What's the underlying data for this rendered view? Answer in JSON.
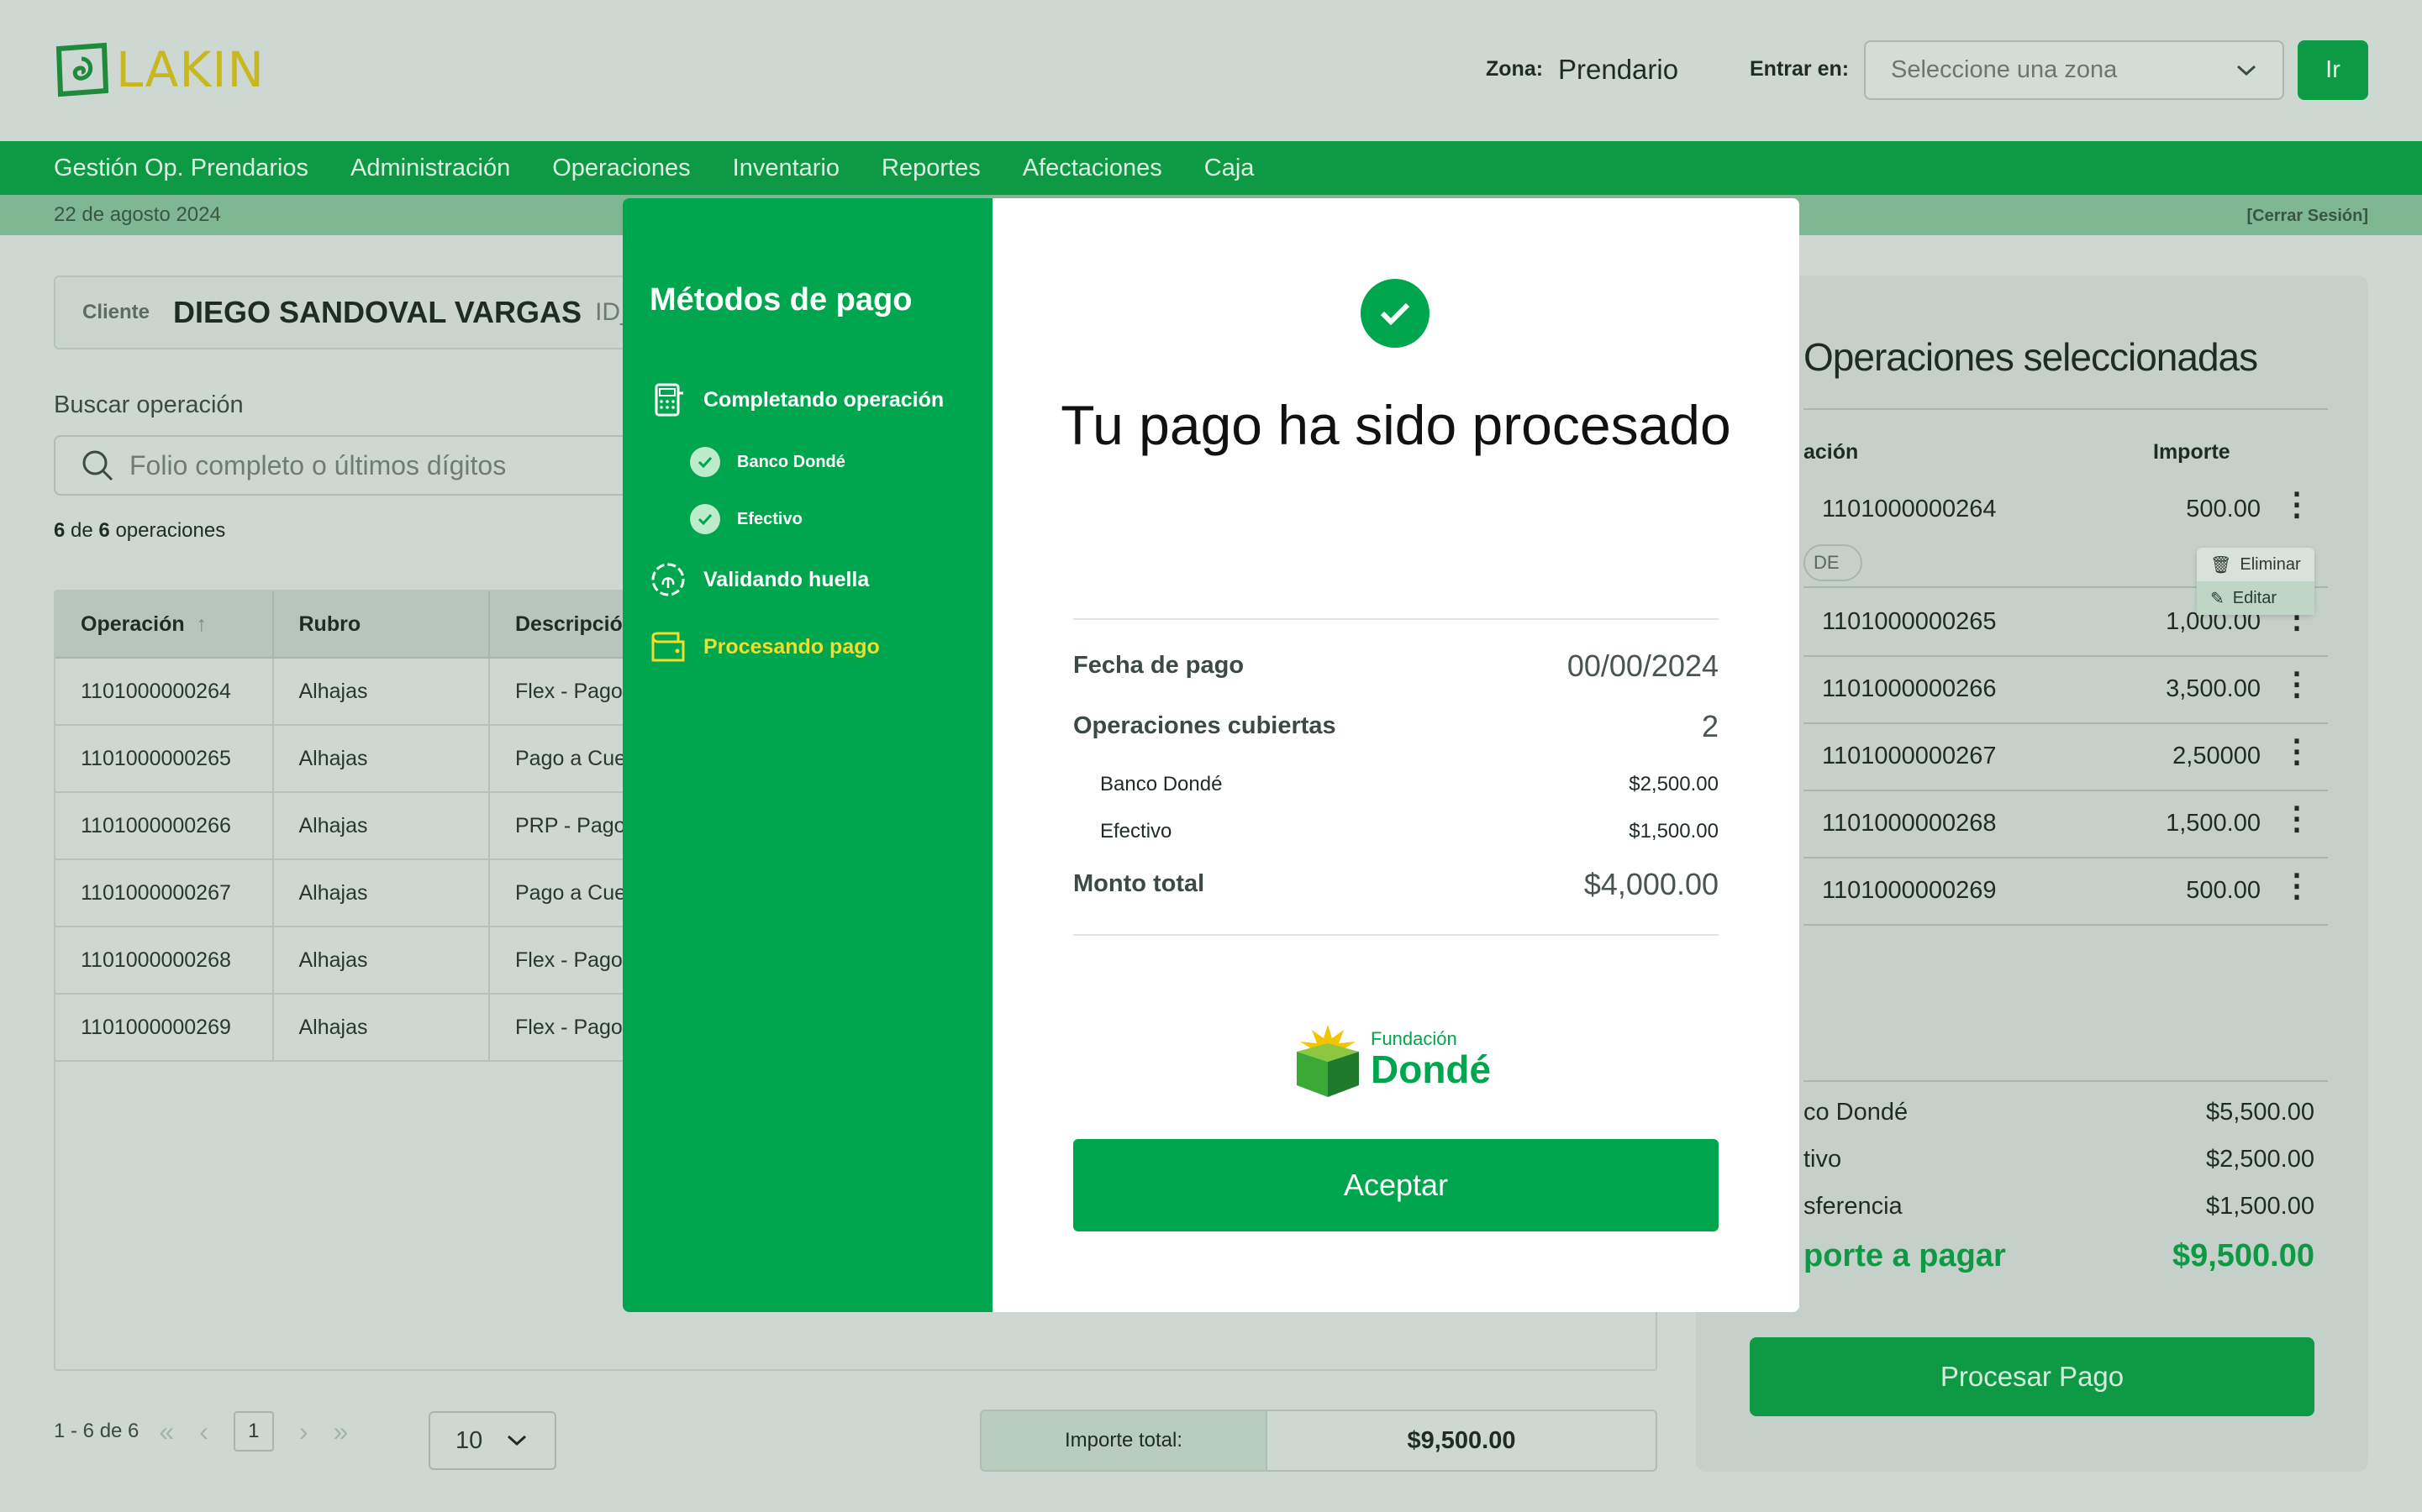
{
  "header": {
    "logo_text": "LAKIN",
    "zona_label": "Zona:",
    "zona_value": "Prendario",
    "entrar_label": "Entrar en:",
    "zone_placeholder": "Seleccione una zona",
    "go_label": "Ir"
  },
  "nav": [
    "Gestión Op. Prendarios",
    "Administración",
    "Operaciones",
    "Inventario",
    "Reportes",
    "Afectaciones",
    "Caja"
  ],
  "subbar": {
    "date": "22 de agosto 2024",
    "logout": "[Cerrar Sesión]"
  },
  "client": {
    "label": "Cliente",
    "name": "DIEGO SANDOVAL VARGAS",
    "id": "ID_"
  },
  "search": {
    "label": "Buscar operación",
    "placeholder": "Folio completo o últimos dígitos"
  },
  "count": {
    "shown": "6",
    "of_text": "de",
    "total": "6",
    "suffix": "operaciones"
  },
  "table": {
    "headers": [
      "Operación",
      "Rubro",
      "Descripció"
    ],
    "rows": [
      [
        "1101000000264",
        "Alhajas",
        "Flex - Pago"
      ],
      [
        "1101000000265",
        "Alhajas",
        "Pago a Cue"
      ],
      [
        "1101000000266",
        "Alhajas",
        "PRP - Pago"
      ],
      [
        "1101000000267",
        "Alhajas",
        "Pago a Cue"
      ],
      [
        "1101000000268",
        "Alhajas",
        "Flex - Pago"
      ],
      [
        "1101000000269",
        "Alhajas",
        "Flex - Pago"
      ]
    ]
  },
  "pagination": {
    "range": "1 - 6 de 6",
    "page": "1",
    "per_page": "10"
  },
  "importe_total": {
    "label": "Importe total:",
    "value": "$9,500.00"
  },
  "selected": {
    "title": "Operaciones seleccionadas",
    "head_op": "ación",
    "head_imp": "Importe",
    "rows": [
      {
        "op": "1101000000264",
        "amount": "500.00"
      },
      {
        "op": "1101000000265",
        "amount": "1,000.00"
      },
      {
        "op": "1101000000266",
        "amount": "3,500.00"
      },
      {
        "op": "1101000000267",
        "amount": "2,50000"
      },
      {
        "op": "1101000000268",
        "amount": "1,500.00"
      },
      {
        "op": "1101000000269",
        "amount": "500.00"
      }
    ],
    "tag": "DE",
    "menu": {
      "delete": "Eliminar",
      "edit": "Editar"
    },
    "summary": [
      {
        "label": "co Dondé",
        "value": "$5,500.00"
      },
      {
        "label": "tivo",
        "value": "$2,500.00"
      },
      {
        "label": "sferencia",
        "value": "$1,500.00"
      }
    ],
    "total_label": "porte a pagar",
    "total_value": "$9,500.00",
    "process_label": "Procesar Pago"
  },
  "modal": {
    "side_title": "Métodos de pago",
    "steps": {
      "completing": "Completando operación",
      "sub1": "Banco Dondé",
      "sub2": "Efectivo",
      "validating": "Validando huella",
      "processing": "Procesando pago"
    },
    "title": "Tu pago ha sido procesado",
    "fecha_label": "Fecha de pago",
    "fecha_value": "00/00/2024",
    "ops_label": "Operaciones cubiertas",
    "ops_value": "2",
    "banco_label": "Banco Dondé",
    "banco_value": "$2,500.00",
    "efectivo_label": "Efectivo",
    "efectivo_value": "$1,500.00",
    "monto_label": "Monto total",
    "monto_value": "$4,000.00",
    "fund_small": "Fundación",
    "fund_big": "Dondé",
    "accept_label": "Aceptar"
  },
  "colors": {
    "brand_green": "#00a64d",
    "nav_green": "#0e9a45",
    "active_step": "#f2dd2a",
    "logo_gold": "#c8b81e"
  }
}
